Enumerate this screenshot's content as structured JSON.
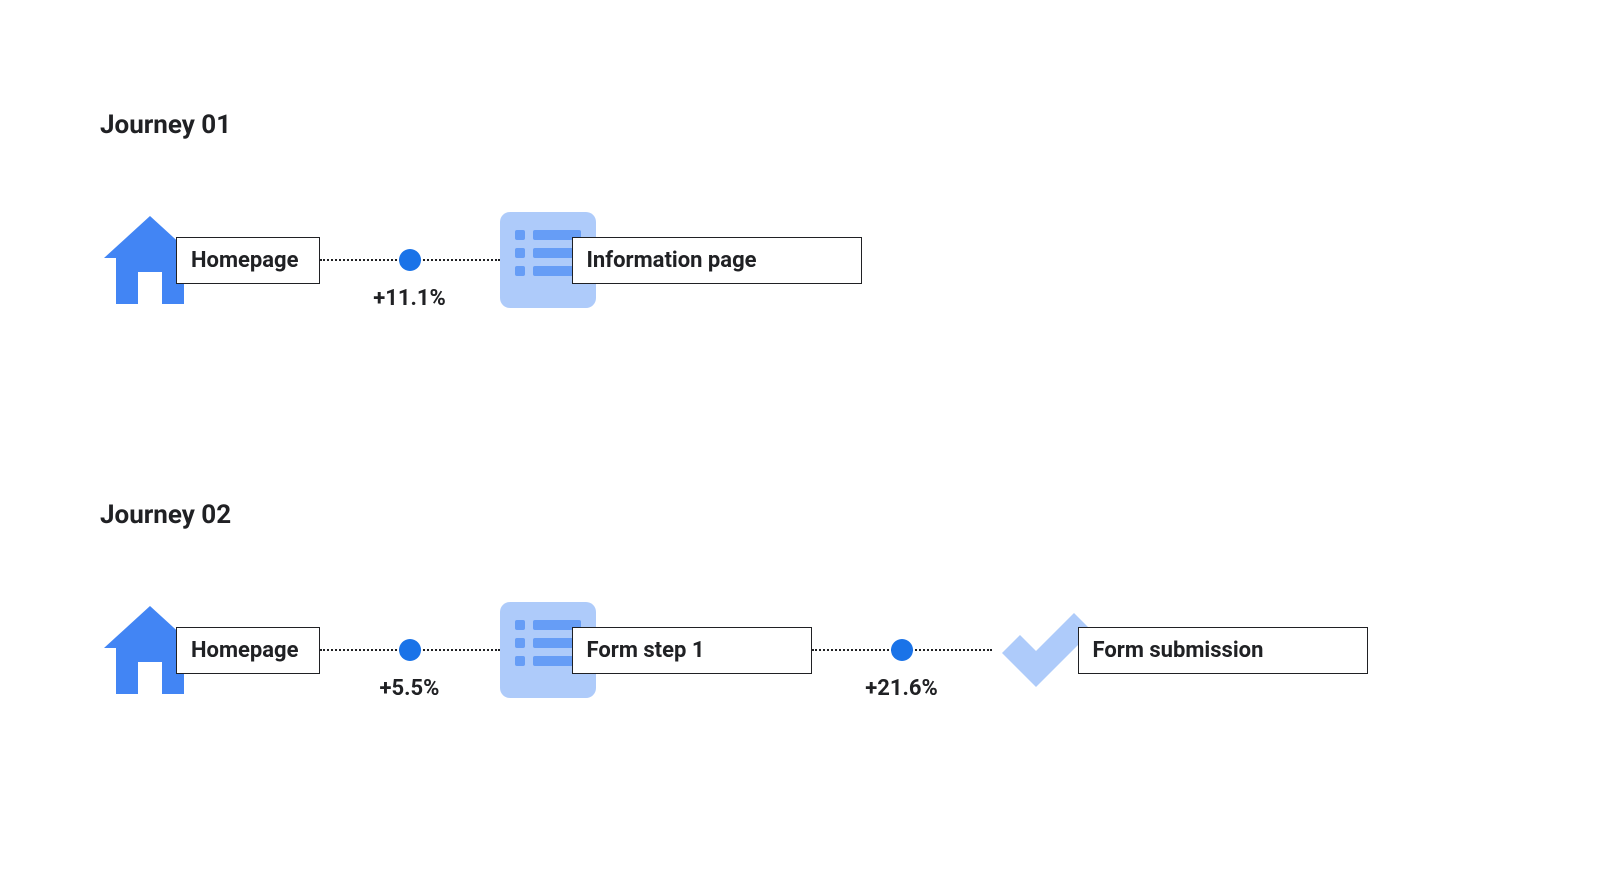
{
  "journeys": [
    {
      "title": "Journey 01",
      "steps": [
        {
          "icon": "home",
          "label": "Homepage"
        },
        {
          "icon": "list",
          "label": "Information page"
        }
      ],
      "transitions": [
        {
          "delta": "+11.1%"
        }
      ]
    },
    {
      "title": "Journey 02",
      "steps": [
        {
          "icon": "home",
          "label": "Homepage"
        },
        {
          "icon": "list",
          "label": "Form step 1"
        },
        {
          "icon": "check",
          "label": "Form submission"
        }
      ],
      "transitions": [
        {
          "delta": "+5.5%"
        },
        {
          "delta": "+21.6%"
        }
      ]
    }
  ],
  "colors": {
    "primary": "#4285f4",
    "primary_dark": "#1a73e8",
    "light": "#aecbfa",
    "mid": "#669df6",
    "text": "#202124"
  }
}
